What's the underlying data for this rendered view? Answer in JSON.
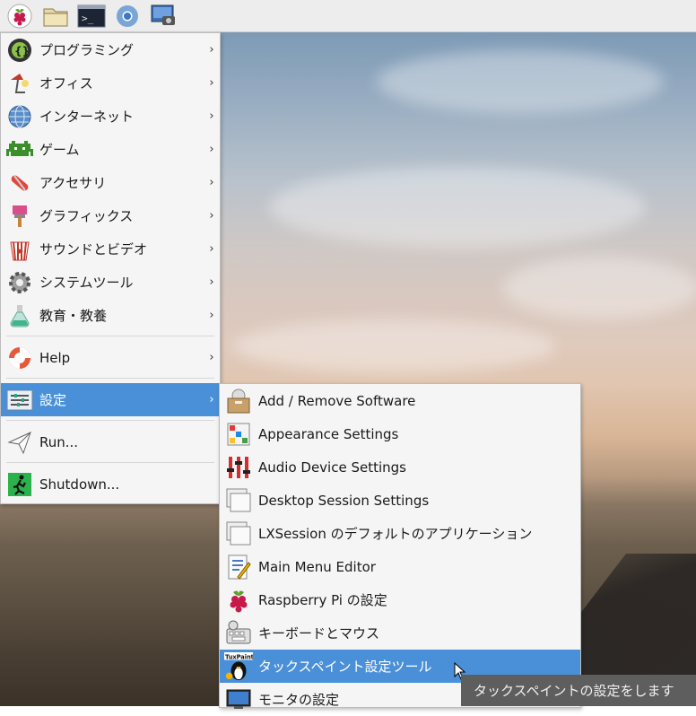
{
  "panel": {
    "icons": [
      "raspberry-menu-icon",
      "file-manager-icon",
      "terminal-icon",
      "chromium-icon",
      "screenshot-icon"
    ],
    "terminal_text": ">_"
  },
  "main_menu": {
    "items": [
      {
        "label": "プログラミング",
        "icon": "programming-icon"
      },
      {
        "label": "オフィス",
        "icon": "office-icon"
      },
      {
        "label": "インターネット",
        "icon": "internet-icon"
      },
      {
        "label": "ゲーム",
        "icon": "games-icon"
      },
      {
        "label": "アクセサリ",
        "icon": "accessories-icon"
      },
      {
        "label": "グラフィックス",
        "icon": "graphics-icon"
      },
      {
        "label": "サウンドとビデオ",
        "icon": "sound-video-icon"
      },
      {
        "label": "システムツール",
        "icon": "system-tools-icon"
      },
      {
        "label": "教育・教養",
        "icon": "education-icon"
      },
      {
        "label": "Help",
        "icon": "help-icon"
      },
      {
        "label": "設定",
        "icon": "preferences-icon"
      },
      {
        "label": "Run...",
        "icon": "run-icon"
      },
      {
        "label": "Shutdown...",
        "icon": "shutdown-icon"
      }
    ],
    "arrow": "›"
  },
  "sub_menu": {
    "items": [
      {
        "label": "Add / Remove Software",
        "icon": "package-icon"
      },
      {
        "label": "Appearance Settings",
        "icon": "appearance-icon"
      },
      {
        "label": "Audio Device Settings",
        "icon": "audio-mixer-icon"
      },
      {
        "label": "Desktop Session Settings",
        "icon": "window-icon"
      },
      {
        "label": "LXSession のデフォルトのアプリケーション",
        "icon": "window-icon"
      },
      {
        "label": "Main Menu Editor",
        "icon": "menu-editor-icon"
      },
      {
        "label": "Raspberry Pi の設定",
        "icon": "raspberry-icon"
      },
      {
        "label": "キーボードとマウス",
        "icon": "keyboard-mouse-icon"
      },
      {
        "label": "タックスペイント設定ツール",
        "icon": "tuxpaint-icon",
        "badge": "TuxPaint"
      },
      {
        "label": "モニタの設定",
        "icon": "monitor-icon"
      }
    ]
  },
  "tooltip": {
    "text": "タックスペイントの設定をします"
  },
  "colors": {
    "highlight": "#4a90d9",
    "menu_bg": "#f5f5f5",
    "tooltip_bg": "#5e5e5e"
  }
}
